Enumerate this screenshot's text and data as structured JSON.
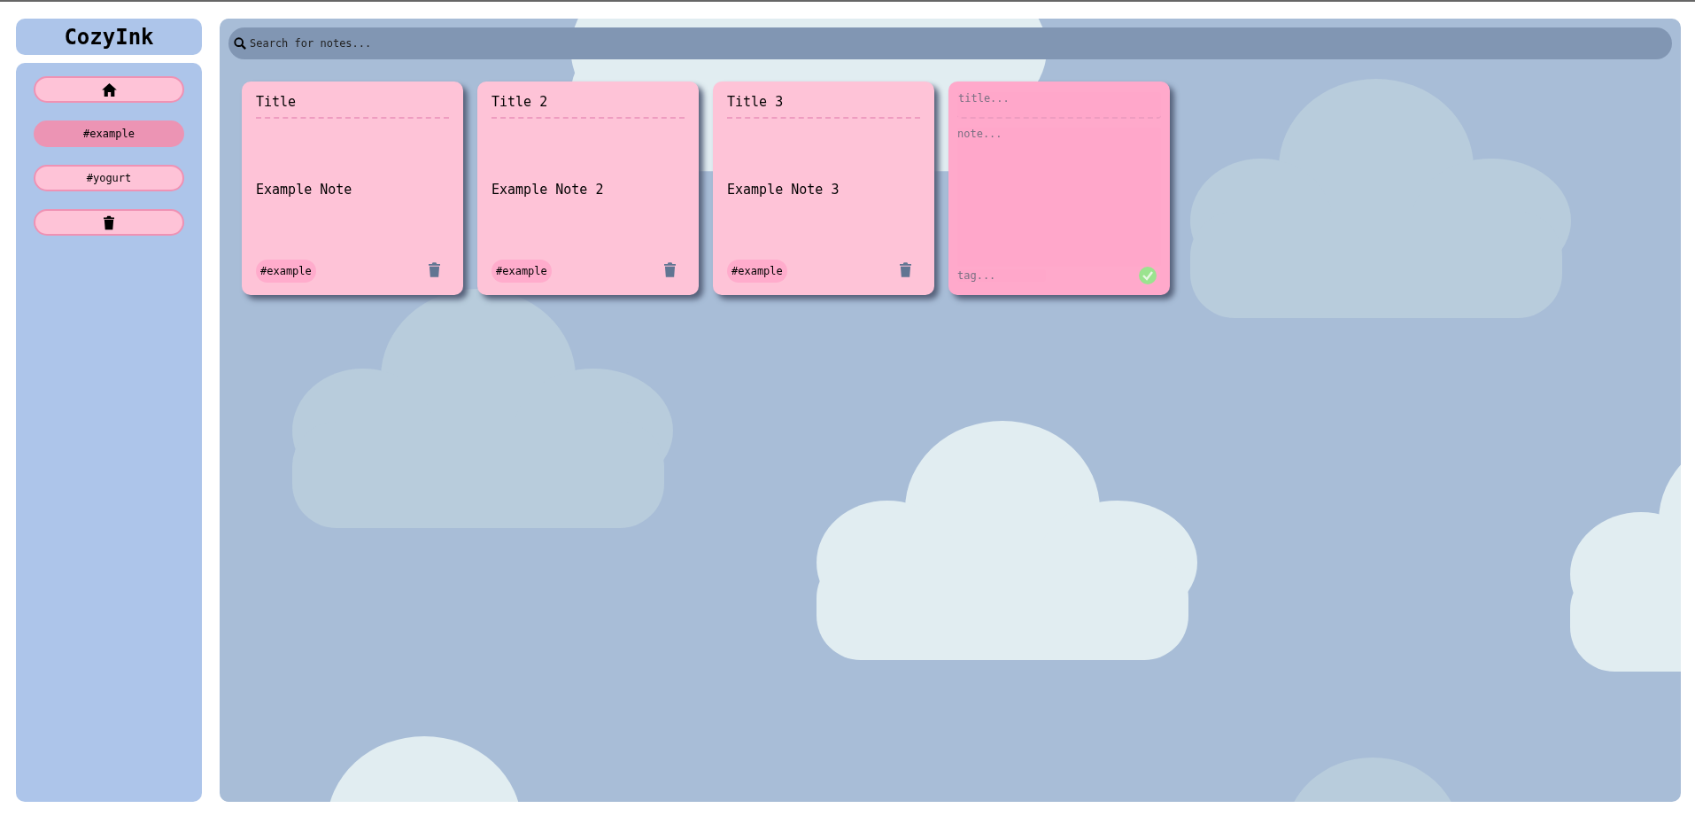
{
  "app_title": "CozyInk",
  "sidebar": {
    "items": [
      {
        "kind": "home",
        "selected": false
      },
      {
        "kind": "tag",
        "label": "#example",
        "selected": true
      },
      {
        "kind": "tag",
        "label": "#yogurt",
        "selected": false
      },
      {
        "kind": "trash",
        "selected": false
      }
    ]
  },
  "search": {
    "placeholder": "Search for notes..."
  },
  "notes": [
    {
      "title": "Title",
      "body": "Example Note",
      "tag": "#example"
    },
    {
      "title": "Title 2",
      "body": "Example Note 2",
      "tag": "#example"
    },
    {
      "title": "Title 3",
      "body": "Example Note 3",
      "tag": "#example"
    }
  ],
  "new_note": {
    "title_placeholder": "title...",
    "note_placeholder": "note...",
    "tag_placeholder": "tag..."
  }
}
